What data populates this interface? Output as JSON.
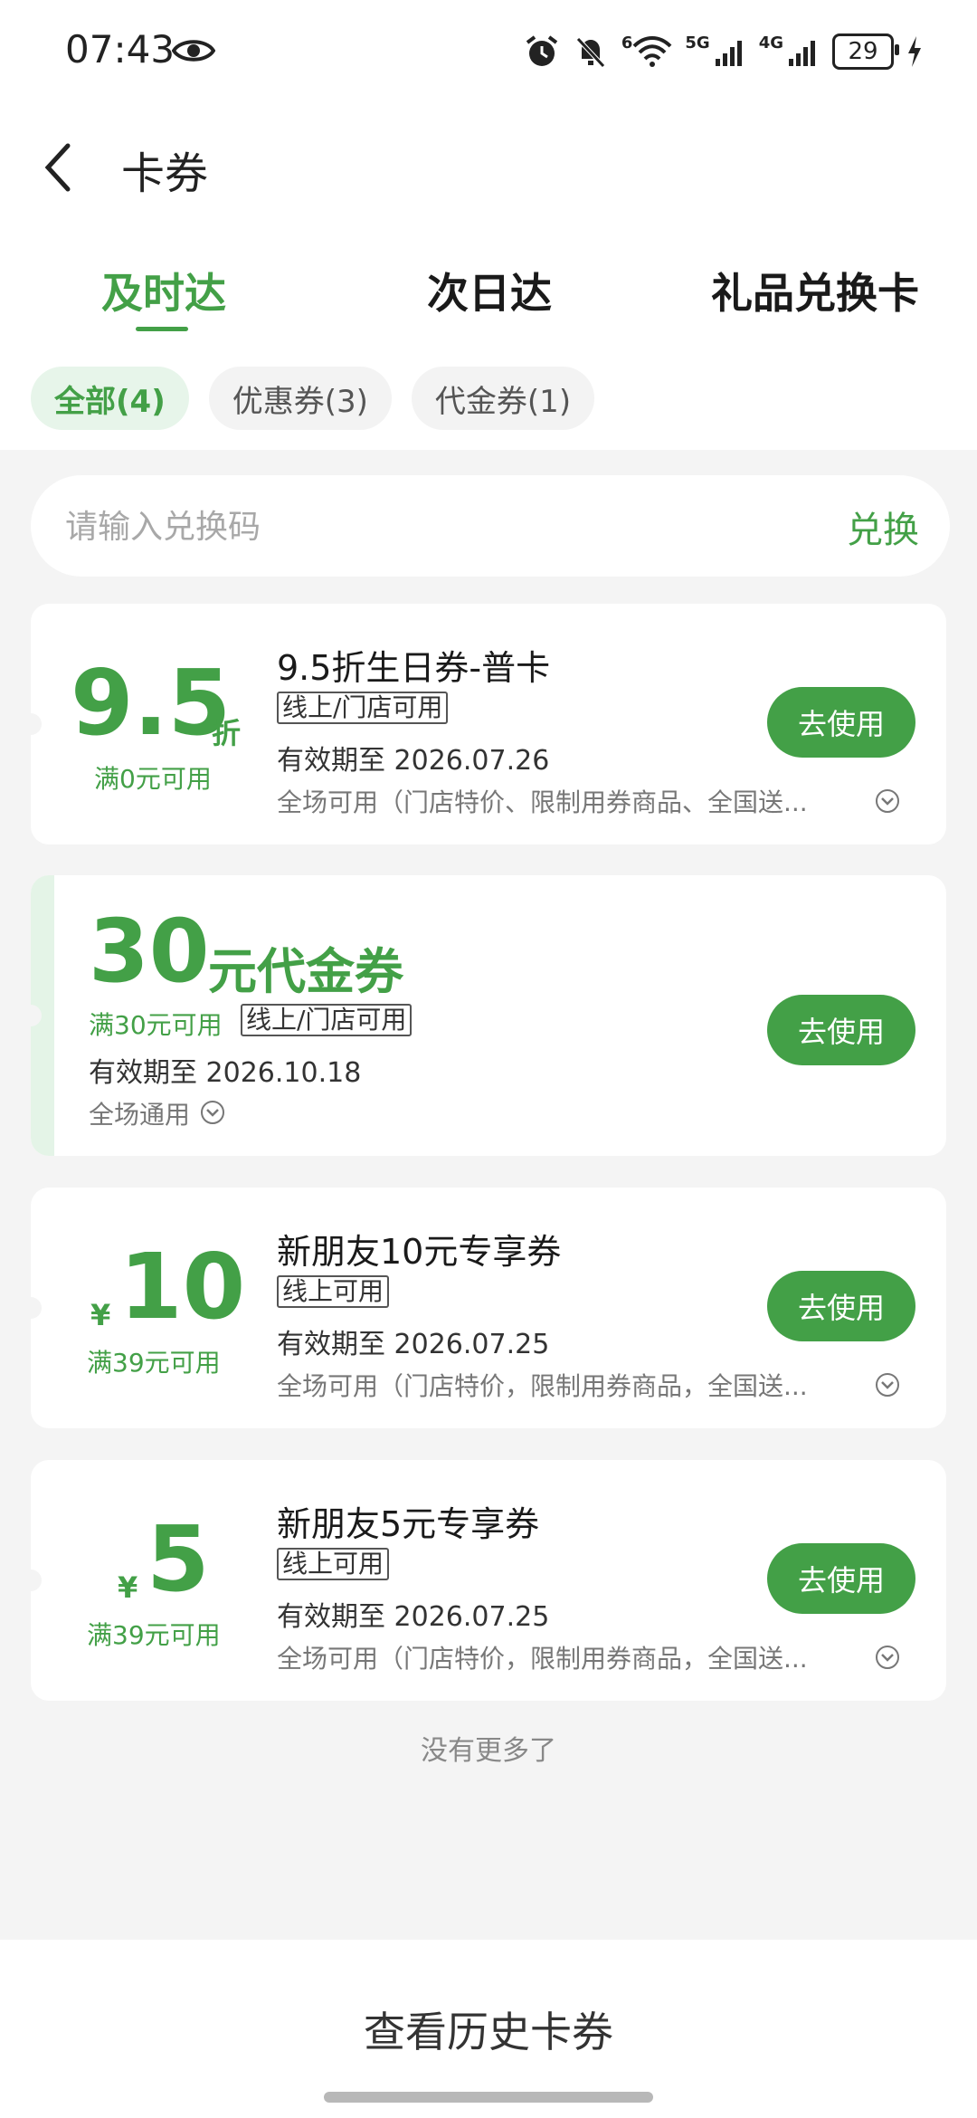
{
  "status_bar": {
    "time": "07:43",
    "battery": "29",
    "signal_label_1": "5G",
    "signal_label_2": "4G",
    "wifi_label": "6"
  },
  "header": {
    "title": "卡券"
  },
  "tabs": [
    {
      "label": "及时达"
    },
    {
      "label": "次日达"
    },
    {
      "label": "礼品兑换卡"
    }
  ],
  "chips": [
    {
      "label": "全部(4)"
    },
    {
      "label": "优惠券(3)"
    },
    {
      "label": "代金券(1)"
    }
  ],
  "redeem": {
    "placeholder": "请输入兑换码",
    "button": "兑换"
  },
  "coupons": [
    {
      "amount": "9.5",
      "unit": "折",
      "condition": "满0元可用",
      "title": "9.5折生日券-普卡",
      "tag": "线上/门店可用",
      "valid": "有效期至 2026.07.26",
      "desc": "全场可用（门店特价、限制用券商品、全国送...",
      "button": "去使用"
    },
    {
      "amount": "30",
      "unit": "元代金券",
      "condition": "满30元可用",
      "tag": "线上/门店可用",
      "valid": "有效期至 2026.10.18",
      "desc": "全场通用",
      "button": "去使用"
    },
    {
      "currency": "¥",
      "amount": "10",
      "condition": "满39元可用",
      "title": "新朋友10元专享券",
      "tag": "线上可用",
      "valid": "有效期至 2026.07.25",
      "desc": "全场可用（门店特价，限制用券商品，全国送...",
      "button": "去使用"
    },
    {
      "currency": "¥",
      "amount": "5",
      "condition": "满39元可用",
      "title": "新朋友5元专享券",
      "tag": "线上可用",
      "valid": "有效期至 2026.07.25",
      "desc": "全场可用（门店特价，限制用券商品，全国送...",
      "button": "去使用"
    }
  ],
  "footer": {
    "no_more": "没有更多了",
    "history_button": "查看历史卡券"
  },
  "colors": {
    "accent": "#43a047",
    "accent_light": "#e7f5ea",
    "background": "#f4f4f4"
  }
}
